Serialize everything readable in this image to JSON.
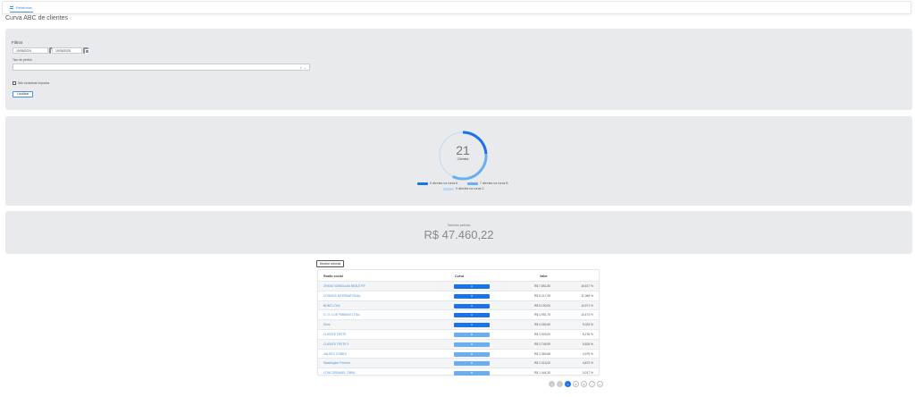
{
  "nav": {
    "tab_label": "Relatórios"
  },
  "page": {
    "title": "Curva ABC de clientes"
  },
  "filters": {
    "title": "Filtros",
    "start_date": "19/05/2024",
    "end_date": "19/05/2025",
    "type_label": "Tipo de pedido",
    "type_clear": "×",
    "type_dropdown": "⌄",
    "exclude_label": "Não considerar impostos",
    "search_label": "Localizar"
  },
  "summary": {
    "total_clients": "21",
    "clients_label": "Clientes",
    "legend": [
      {
        "label": "5 clientes na curva A",
        "color": "#1a73e8"
      },
      {
        "label": "7 clientes na curva B",
        "color": "#6aaef2"
      },
      {
        "label": "9 clientes na curva C",
        "color": "#bcd9f7"
      }
    ],
    "curve_counts": {
      "A": 5,
      "B": 7,
      "C": 9
    }
  },
  "total": {
    "label": "Total dos pedidos",
    "value": "R$ 47.460,22"
  },
  "table": {
    "toggle_label": "Mostrar colunas",
    "headers": {
      "name": "Razão social",
      "curve": "Curva",
      "value": "Valor"
    },
    "rows": [
      {
        "name": "ZHANG WANGLIAN BEAUTIFF",
        "curve": "A",
        "value": "R$ 7.851,50",
        "percent": "16,617 %"
      },
      {
        "name": "COSMOS INTERNATIONAL",
        "curve": "A",
        "value": "R$ 5.217,09",
        "percent": "11,068 %"
      },
      {
        "name": "BOBÓ LTDA",
        "curve": "A",
        "value": "R$ 5.190,00",
        "percent": "10,971 %"
      },
      {
        "name": "G. O. L DE FABIANO LTDA",
        "curve": "A",
        "value": "R$ 4.951,70",
        "percent": "10,474 %"
      },
      {
        "name": "Sinol",
        "curve": "A",
        "value": "R$ 4.282,60",
        "percent": "9,023 %"
      },
      {
        "name": "CLIENTE TESTE",
        "curve": "B",
        "value": "R$ 3.929,00",
        "percent": "8,278 %"
      },
      {
        "name": "CLIENTE TESTE 3",
        "curve": "B",
        "value": "R$ 2.746,99",
        "percent": "5,628 %"
      },
      {
        "name": "VALDEC COMEX",
        "curve": "B",
        "value": "R$ 2.363,68",
        "percent": "4,979 %"
      },
      {
        "name": "Washington Ferreira",
        "curve": "B",
        "value": "R$ 2.313,00",
        "percent": "4,873 %"
      },
      {
        "name": "CONCORDAVEL OBRA",
        "curve": "B",
        "value": "R$ 1.444,30",
        "percent": "3,017 %"
      }
    ]
  },
  "pagination": {
    "first": "«",
    "prev": "‹",
    "pages": [
      "1",
      "2",
      "3"
    ],
    "next": "›",
    "last": "»"
  }
}
